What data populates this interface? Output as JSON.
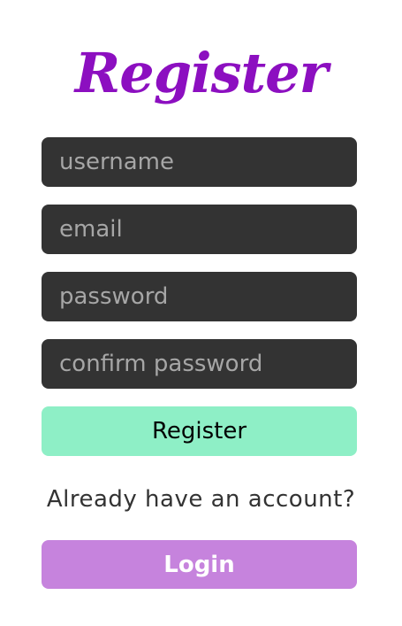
{
  "form": {
    "title": "Register",
    "fields": [
      {
        "placeholder": "username",
        "value": ""
      },
      {
        "placeholder": "email",
        "value": ""
      },
      {
        "placeholder": "password",
        "value": ""
      },
      {
        "placeholder": "confirm password",
        "value": ""
      }
    ],
    "register_label": "Register",
    "account_prompt": "Already have an account?",
    "login_label": "Login"
  },
  "colors": {
    "title": "#8c0fc0",
    "field_bg": "#333333",
    "register_bg": "#8eefc6",
    "login_bg": "#c683dd"
  }
}
